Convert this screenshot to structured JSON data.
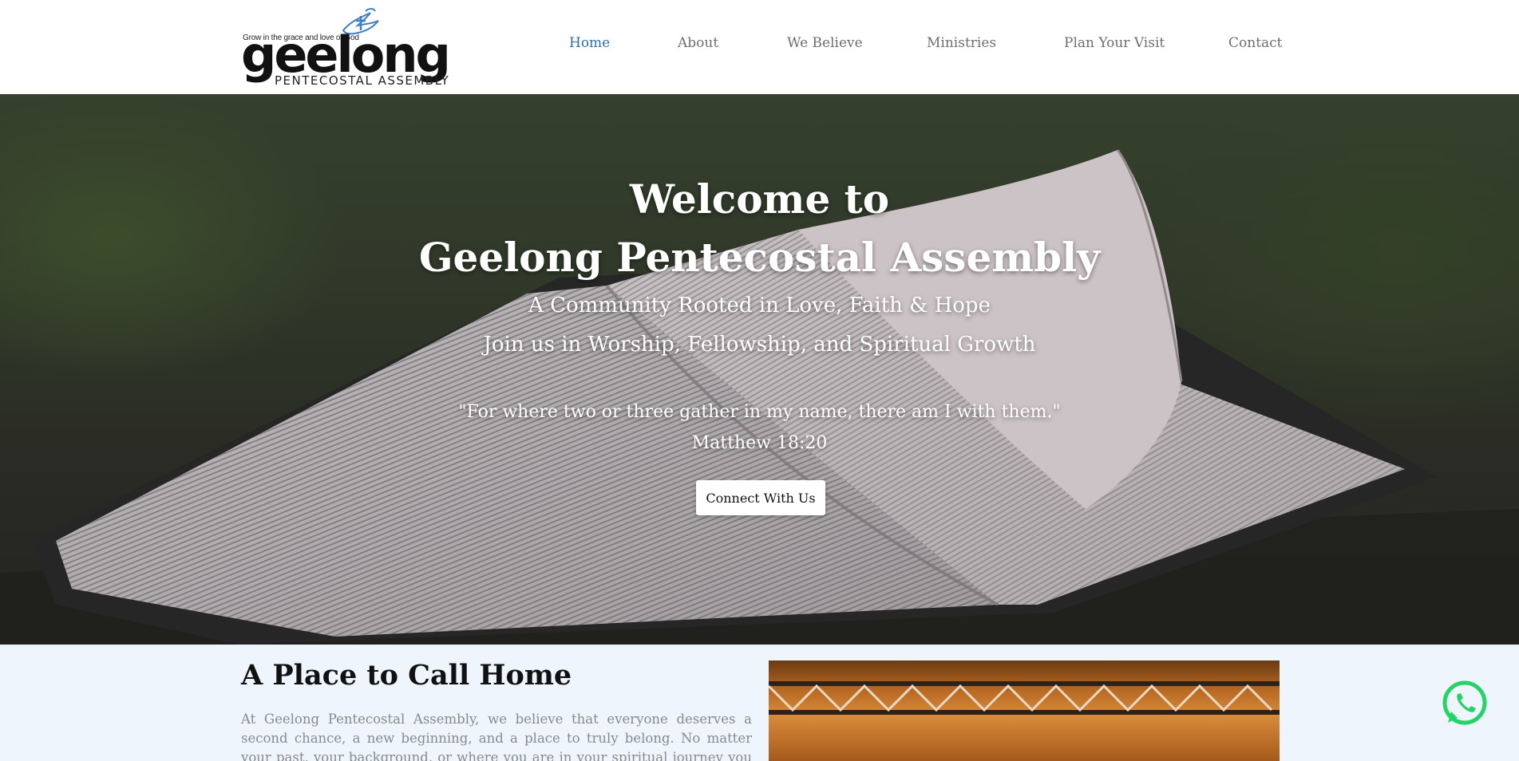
{
  "logo": {
    "tagline": "Grow in the grace and love of God",
    "name": "geelong",
    "subname": "PENTECOSTAL ASSEMBLY"
  },
  "nav": {
    "items": [
      {
        "label": "Home",
        "active": true
      },
      {
        "label": "About"
      },
      {
        "label": "We Believe"
      },
      {
        "label": "Ministries"
      },
      {
        "label": "Plan Your Visit"
      },
      {
        "label": "Contact"
      }
    ]
  },
  "hero": {
    "title_line1": "Welcome to",
    "title_line2": "Geelong Pentecostal Assembly",
    "subtitle_line1": "A Community Rooted in Love, Faith & Hope",
    "subtitle_line2": "Join us in Worship, Fellowship, and Spiritual Growth",
    "quote": "\"For where two or three gather in my name, there am I with them.\"",
    "reference": "Matthew 18:20",
    "cta_label": "Connect With Us"
  },
  "about": {
    "heading": "A Place to Call Home",
    "body": "At Geelong Pentecostal Assembly, we believe that everyone deserves a second chance, a new beginning, and a place to truly belong. No matter your past, your background, or where you are in your spiritual journey you are welcome here."
  },
  "colors": {
    "nav_active": "#2f6ea8",
    "nav_default": "#6e6e6e",
    "section_bg": "#eef5fc",
    "whatsapp": "#25d366"
  },
  "icons": {
    "whatsapp": "whatsapp-icon",
    "logo_dove": "dove-icon"
  }
}
